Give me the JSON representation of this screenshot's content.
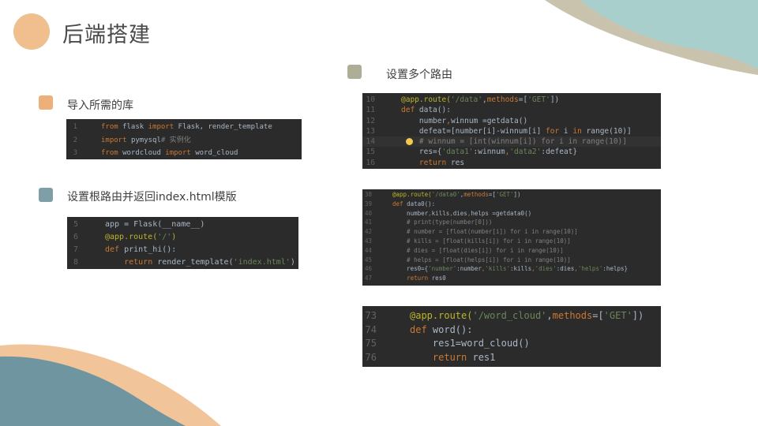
{
  "title": "后端搭建",
  "sections": {
    "import": "导入所需的库",
    "root": "设置根路由并返回index.html模版",
    "routes": "设置多个路由"
  },
  "colors": {
    "orange": "#eeb07a",
    "blue_gray": "#7f9fa8",
    "olive": "#aeae96",
    "deco_teal": "#a9cfcc",
    "deco_tan": "#c9c3ad",
    "deco_peach": "#f2c49a",
    "deco_slate": "#6f95a0"
  },
  "code1": {
    "lines": [
      {
        "n": "1",
        "segs": [
          [
            "kw",
            "from "
          ],
          [
            "",
            "flask "
          ],
          [
            "kw",
            "import "
          ],
          [
            "",
            "Flask, render_template"
          ]
        ]
      },
      {
        "n": "2",
        "segs": [
          [
            "kw",
            "import "
          ],
          [
            "",
            "pymysql"
          ],
          [
            "cm",
            "# 实例化"
          ]
        ]
      },
      {
        "n": "3",
        "segs": [
          [
            "kw",
            "from "
          ],
          [
            "",
            "wordcloud "
          ],
          [
            "kw",
            "import "
          ],
          [
            "",
            "word_cloud"
          ]
        ]
      }
    ]
  },
  "code2": {
    "lines": [
      {
        "n": "5",
        "segs": [
          [
            "",
            "app = Flask(__name__)"
          ]
        ]
      },
      {
        "n": "6",
        "segs": [
          [
            "dec",
            "@app.route("
          ],
          [
            "str",
            "'/'"
          ],
          [
            "dec",
            ")"
          ]
        ]
      },
      {
        "n": "7",
        "segs": [
          [
            "kw",
            "def "
          ],
          [
            "",
            "print_hi():"
          ]
        ]
      },
      {
        "n": "8",
        "segs": [
          [
            "",
            "    "
          ],
          [
            "kw",
            "return "
          ],
          [
            "",
            "render_template("
          ],
          [
            "str",
            "'index.html'"
          ],
          [
            "",
            ")"
          ]
        ]
      }
    ]
  },
  "code3": {
    "lines": [
      {
        "n": "10",
        "segs": [
          [
            "dec",
            "@app.route("
          ],
          [
            "str",
            "'/data'"
          ],
          [
            "",
            ","
          ],
          [
            "kw",
            "methods"
          ],
          [
            "",
            "=["
          ],
          [
            "str",
            "'GET'"
          ],
          [
            "",
            "])"
          ]
        ]
      },
      {
        "n": "11",
        "segs": [
          [
            "kw",
            "def "
          ],
          [
            "",
            "data():"
          ]
        ]
      },
      {
        "n": "12",
        "segs": [
          [
            "",
            "    number"
          ],
          [
            "kw",
            ","
          ],
          [
            "",
            "winnum =getdata()"
          ]
        ]
      },
      {
        "n": "13",
        "segs": [
          [
            "",
            "    defeat=[number[i]-winnum[i] "
          ],
          [
            "kw",
            "for "
          ],
          [
            "",
            "i "
          ],
          [
            "kw",
            "in "
          ],
          [
            "",
            "range(10)]"
          ]
        ]
      },
      {
        "n": "14",
        "segs": [
          [
            "cm",
            "    # winnum = [int(winnum[i]) for i in range(10)]"
          ]
        ]
      },
      {
        "n": "15",
        "segs": [
          [
            "",
            "    res={"
          ],
          [
            "str",
            "'data1'"
          ],
          [
            "",
            ":winnum"
          ],
          [
            "kw",
            ","
          ],
          [
            "str",
            "'data2'"
          ],
          [
            "",
            ":defeat}"
          ]
        ]
      },
      {
        "n": "16",
        "segs": [
          [
            "",
            "    "
          ],
          [
            "kw",
            "return "
          ],
          [
            "",
            "res"
          ]
        ]
      }
    ]
  },
  "code4": {
    "lines": [
      {
        "n": "38",
        "segs": [
          [
            "dec",
            "@app.route("
          ],
          [
            "str",
            "'/data0'"
          ],
          [
            "",
            ","
          ],
          [
            "kw",
            "methods"
          ],
          [
            "",
            "=["
          ],
          [
            "str",
            "'GET'"
          ],
          [
            "",
            "])"
          ]
        ]
      },
      {
        "n": "39",
        "segs": [
          [
            "kw",
            "def "
          ],
          [
            "",
            "data0():"
          ]
        ]
      },
      {
        "n": "40",
        "segs": [
          [
            "",
            "    number"
          ],
          [
            "kw",
            ","
          ],
          [
            "",
            "kills"
          ],
          [
            "kw",
            ","
          ],
          [
            "",
            "dies"
          ],
          [
            "kw",
            ","
          ],
          [
            "",
            "helps =getdata0()"
          ]
        ]
      },
      {
        "n": "41",
        "segs": [
          [
            "cm",
            "    # print(type(number[0]))"
          ]
        ]
      },
      {
        "n": "42",
        "segs": [
          [
            "cm",
            "    # number = [float(number[i]) for i in range(10)]"
          ]
        ]
      },
      {
        "n": "43",
        "segs": [
          [
            "cm",
            "    # kills = [float(kills[i]) for i in range(10)]"
          ]
        ]
      },
      {
        "n": "44",
        "segs": [
          [
            "cm",
            "    # dies = [float(dies[i]) for i in range(10)]"
          ]
        ]
      },
      {
        "n": "45",
        "segs": [
          [
            "cm",
            "    # helps = [float(helps[i]) for i in range(10)]"
          ]
        ]
      },
      {
        "n": "46",
        "segs": [
          [
            "",
            "    res0={"
          ],
          [
            "str",
            "'number'"
          ],
          [
            "",
            ":number"
          ],
          [
            "kw",
            ","
          ],
          [
            "str",
            "'kills'"
          ],
          [
            "",
            ":kills"
          ],
          [
            "kw",
            ","
          ],
          [
            "str",
            "'dies'"
          ],
          [
            "",
            ":dies"
          ],
          [
            "kw",
            ","
          ],
          [
            "str",
            "'helps'"
          ],
          [
            "",
            ":helps}"
          ]
        ]
      },
      {
        "n": "47",
        "segs": [
          [
            "",
            "    "
          ],
          [
            "kw",
            "return "
          ],
          [
            "",
            "res0"
          ]
        ]
      }
    ]
  },
  "code5": {
    "lines": [
      {
        "n": "73",
        "segs": [
          [
            "dec",
            "@app.route("
          ],
          [
            "str",
            "'/word_cloud'"
          ],
          [
            "",
            ","
          ],
          [
            "kw",
            "methods"
          ],
          [
            "",
            "=["
          ],
          [
            "str",
            "'GET'"
          ],
          [
            "",
            "])"
          ]
        ]
      },
      {
        "n": "74",
        "segs": [
          [
            "kw",
            "def "
          ],
          [
            "",
            "word():"
          ]
        ]
      },
      {
        "n": "75",
        "segs": [
          [
            "",
            "    res1=word_cloud()"
          ]
        ]
      },
      {
        "n": "76",
        "segs": [
          [
            "",
            "    "
          ],
          [
            "kw",
            "return "
          ],
          [
            "",
            "res1"
          ]
        ]
      }
    ]
  }
}
